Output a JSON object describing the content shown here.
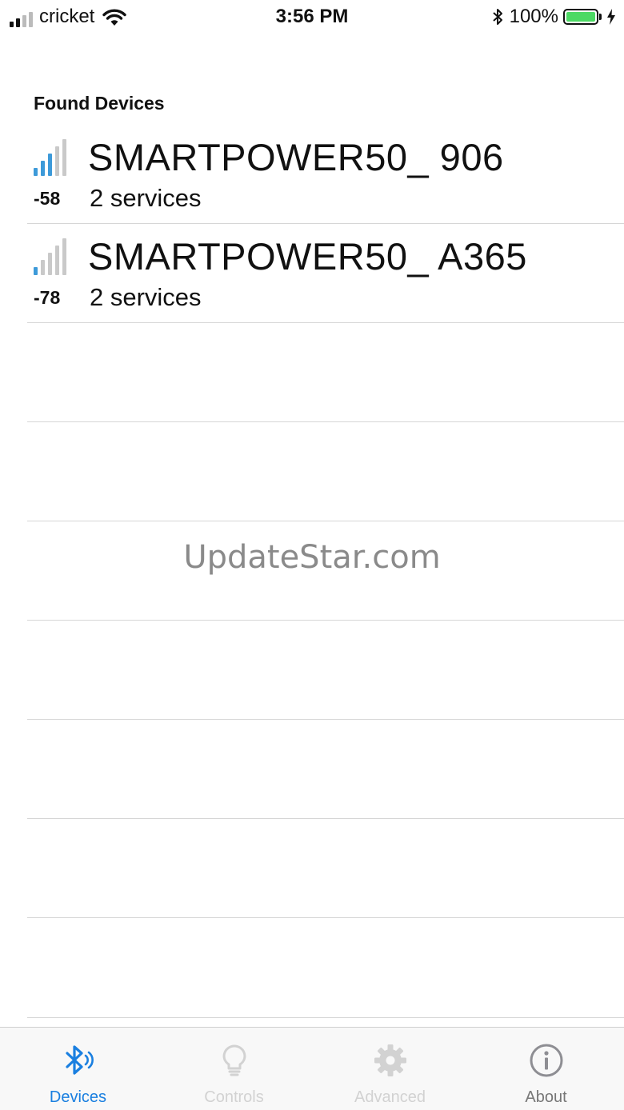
{
  "status_bar": {
    "carrier": "cricket",
    "time": "3:56 PM",
    "battery": "100%"
  },
  "devices_section": {
    "title": "Found Devices",
    "devices": [
      {
        "name": "SMARTPOWER50_ 906",
        "rssi": "-58",
        "services": "2 services",
        "signal_bars": 3
      },
      {
        "name": "SMARTPOWER50_ A365",
        "rssi": "-78",
        "services": "2 services",
        "signal_bars": 1
      }
    ]
  },
  "watermark": "UpdateStar.com",
  "tab_bar": {
    "tabs": [
      {
        "label": "Devices",
        "icon": "bluetooth-icon",
        "state": "active"
      },
      {
        "label": "Controls",
        "icon": "lightbulb-icon",
        "state": "disabled"
      },
      {
        "label": "Advanced",
        "icon": "gear-icon",
        "state": "disabled"
      },
      {
        "label": "About",
        "icon": "info-icon",
        "state": "normal"
      }
    ]
  },
  "colors": {
    "accent": "#1a7fe0",
    "signal_active": "#3d9ad9",
    "signal_inactive": "#c9c9c9",
    "disabled": "#d2d2d2",
    "battery": "#4cd964"
  }
}
